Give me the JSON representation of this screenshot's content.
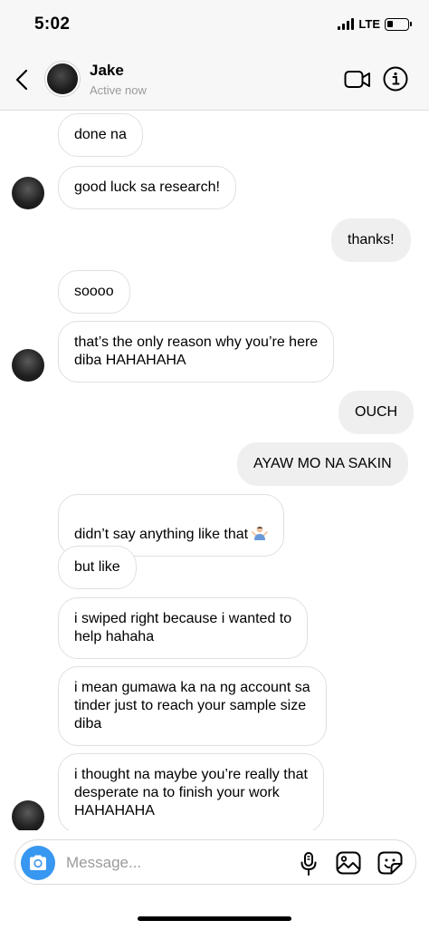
{
  "status_bar": {
    "time": "5:02",
    "network": "LTE",
    "battery_level": 0.3
  },
  "header": {
    "name": "Jake",
    "status": "Active now",
    "back_icon": "chevron-left-icon",
    "video_icon": "video-camera-icon",
    "info_icon": "info-icon"
  },
  "messages": [
    {
      "sender": "Jake",
      "text": "done na"
    },
    {
      "sender": "Jake",
      "text": "good luck sa research!"
    },
    {
      "sender": "me",
      "text": "thanks!"
    },
    {
      "sender": "Jake",
      "text": "soooo"
    },
    {
      "sender": "Jake",
      "text": "that’s the only reason why you’re here\ndiba HAHAHAHA"
    },
    {
      "sender": "me",
      "text": "OUCH"
    },
    {
      "sender": "me",
      "text": "AYAW MO NA SAKIN"
    },
    {
      "sender": "Jake",
      "text": "didn’t say anything like that",
      "emoji": "person-shrugging-emoji"
    },
    {
      "sender": "Jake",
      "text": "but like"
    },
    {
      "sender": "Jake",
      "text": "i swiped right because i wanted to\nhelp hahaha"
    },
    {
      "sender": "Jake",
      "text": "i mean gumawa ka na ng account sa\ntinder just to reach your sample size\ndiba"
    },
    {
      "sender": "Jake",
      "text": "i thought na maybe you’re really that\ndesperate na to finish your work\nHAHAHAHA"
    }
  ],
  "composer": {
    "placeholder": "Message...",
    "value": "",
    "camera_icon": "camera-icon",
    "mic_icon": "microphone-icon",
    "gallery_icon": "photo-gallery-icon",
    "sticker_icon": "sticker-icon"
  },
  "colors": {
    "accent": "#3897f0",
    "sent_bubble": "#efefef",
    "received_border": "#e0e0e0",
    "header_bg": "#f7f7f7"
  }
}
